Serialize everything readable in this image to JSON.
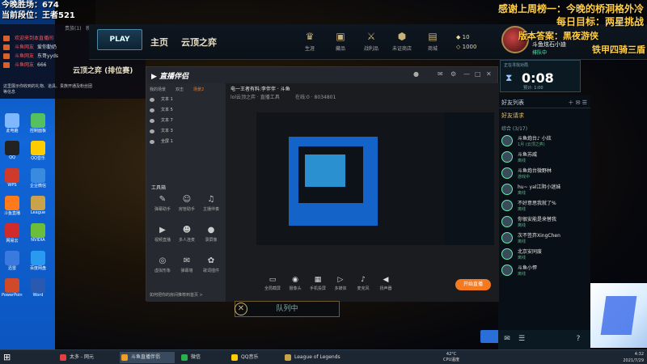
{
  "overlay": {
    "line1": "今晚胜场：674",
    "line2": "当前段位：王者521"
  },
  "overlay_right": {
    "line1": "感谢上周榜一：今晚的桥洞格外冷",
    "line2": "每日目标：两星挑战",
    "line3": "版本答案：黑夜游侠",
    "line4": "铁甲四骑三盾"
  },
  "mini_panel": {
    "tabs": [
      "贵族(1)",
      "粉丝团"
    ],
    "rows": [
      {
        "name": "欢迎来到本直播间",
        "msg": ""
      },
      {
        "name": "斗鱼网友",
        "msg": "爱你勤奶"
      },
      {
        "name": "斗鱼网友",
        "msg": "东哥yyds"
      },
      {
        "name": "斗鱼网友",
        "msg": "666"
      }
    ],
    "footnote": "这里展示你收到的礼物、道具、贵族开通及粉丝团等信息"
  },
  "lol": {
    "play_label": "PLAY",
    "nav": [
      "主页",
      "云顶之弈"
    ],
    "top_icons": [
      {
        "icon": "crown-icon",
        "glyph": "♛",
        "label": "生涯"
      },
      {
        "icon": "chest-icon",
        "glyph": "▣",
        "label": "藏品"
      },
      {
        "icon": "swords-icon",
        "glyph": "⚔",
        "label": "战利品"
      },
      {
        "icon": "hex-icon",
        "glyph": "⬢",
        "label": "未证商店"
      },
      {
        "icon": "shop-icon",
        "glyph": "▤",
        "label": "商城"
      }
    ],
    "currency_rp": "10",
    "currency_be": "1000",
    "player_name": "斗鱼炫石小迪",
    "player_status": "排队中",
    "game_mode": "云顶之弈 (排位赛)",
    "queue_label": "队列中",
    "queue_cancel": "✕"
  },
  "timer": {
    "label": "正在寻找对局",
    "value": "0:08",
    "sub": "预计: 1:00"
  },
  "friends": {
    "header": "好友列表",
    "request": "好友请求",
    "group": "综合 (3/17)",
    "list": [
      {
        "name": "斗鱼炮台♪ 小炫",
        "status": "1月 (云顶之弈)"
      },
      {
        "name": "斗鱼苏威",
        "status": "离线"
      },
      {
        "name": "斗鱼炮台微野林",
        "status": "游戏中"
      },
      {
        "name": "hu~ yal江阴小迷妹",
        "status": "离线"
      },
      {
        "name": "不好意思我就了%",
        "status": "离线"
      },
      {
        "name": "你很安能是来替我",
        "status": "离线"
      },
      {
        "name": "次不签弃XingChen",
        "status": "离线"
      },
      {
        "name": "北京安同废",
        "status": "离线"
      },
      {
        "name": "斗鱼小悍",
        "status": "离线"
      }
    ],
    "start_btn": "开始体验"
  },
  "stream_app": {
    "logo": "直播伴侣",
    "left_tabs": [
      "我的场景",
      "双击",
      "场景2"
    ],
    "scenes": [
      "文本 1",
      "文本 5",
      "文本 7",
      "文本 3",
      "全屏 1"
    ],
    "toolbox_title": "工具箱",
    "tools": [
      {
        "icon": "mic-icon",
        "glyph": "✎",
        "label": "弹幕助手"
      },
      {
        "icon": "user-icon",
        "glyph": "☺",
        "label": "房管助手"
      },
      {
        "icon": "music-icon",
        "glyph": "♫",
        "label": "主播伴奏"
      },
      {
        "icon": "video-icon",
        "glyph": "▶",
        "label": "视频直播"
      },
      {
        "icon": "team-icon",
        "glyph": "☻",
        "label": "多人连麦"
      },
      {
        "icon": "record-icon",
        "glyph": "●",
        "label": "录屏像"
      },
      {
        "icon": "circle-icon",
        "glyph": "◎",
        "label": "虚拟形象"
      },
      {
        "icon": "comment-icon",
        "glyph": "✉",
        "label": "弹幕墙"
      },
      {
        "icon": "gift-icon",
        "glyph": "✿",
        "label": "歌词插件"
      }
    ],
    "footer": "如何把你的房间推荐到首页 >",
    "head_title": "电一王者有料:李伴伴 · 斗鱼",
    "head_tags": "lol云顶之弈 · 直播工具",
    "head_stats": "在线:0 · 8034801",
    "bottom_tools": [
      {
        "icon": "screen-icon",
        "glyph": "▭",
        "label": "全局截屏"
      },
      {
        "icon": "camera-icon",
        "glyph": "◉",
        "label": "摄像头"
      },
      {
        "icon": "phone-icon",
        "glyph": "▦",
        "label": "手机投屏"
      },
      {
        "icon": "media-icon",
        "glyph": "▷",
        "label": "多媒体"
      },
      {
        "icon": "mic2-icon",
        "glyph": "♪",
        "label": "麦克风"
      },
      {
        "icon": "speaker-icon",
        "glyph": "◀",
        "label": "扬声器"
      }
    ],
    "live_button": "开始直播"
  },
  "taskbar": {
    "tasks": [
      {
        "label": "太多 - 网元",
        "color": "#e04040"
      },
      {
        "label": "斗鱼直播伴侣",
        "color": "#f0a020"
      },
      {
        "label": "微信",
        "color": "#2ab04a"
      },
      {
        "label": "QQ音乐",
        "color": "#ffcc00"
      },
      {
        "label": "League of Legends",
        "color": "#c9a24a"
      }
    ],
    "cpu": "42°C",
    "cpu_label": "CPU温度",
    "time": "4:32",
    "date": "2021/7/29"
  },
  "desktop": {
    "icons": [
      {
        "label": "此电脑",
        "color": "#7fb8ff"
      },
      {
        "label": "控制面板",
        "color": "#55c060"
      },
      {
        "label": "QQ",
        "color": "#222"
      },
      {
        "label": "QQ音乐",
        "color": "#ffcc00"
      },
      {
        "label": "WPS",
        "color": "#d03a2a"
      },
      {
        "label": "企业微信",
        "color": "#3a8adf"
      },
      {
        "label": "斗鱼直播",
        "color": "#ff7a1a"
      },
      {
        "label": "League",
        "color": "#c9a24a"
      },
      {
        "label": "网易云",
        "color": "#d02a2a"
      },
      {
        "label": "NVIDIA",
        "color": "#6abe3a"
      },
      {
        "label": "迅雷",
        "color": "#3a7adf"
      },
      {
        "label": "百度网盘",
        "color": "#2a9af0"
      },
      {
        "label": "PowerPoint",
        "color": "#d04a2a"
      },
      {
        "label": "Word",
        "color": "#2a5ab0"
      }
    ]
  }
}
